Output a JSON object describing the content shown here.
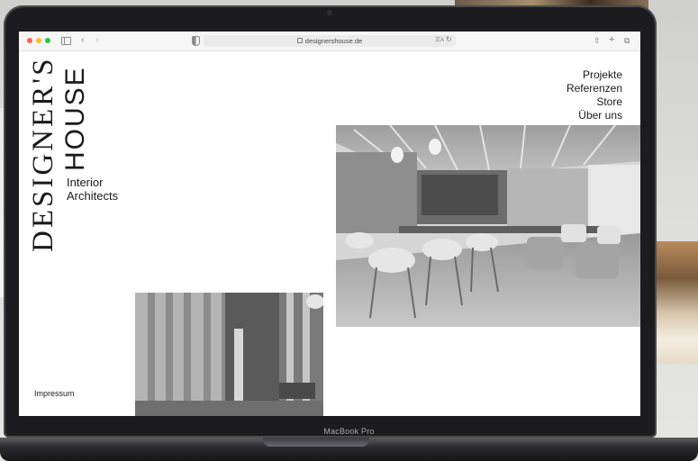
{
  "browser": {
    "url": "designershouse.de"
  },
  "site": {
    "logo_line1": "DESIGNER'S",
    "logo_line2": "HOUSE",
    "tagline": [
      "Interior",
      "Architects"
    ],
    "nav": [
      "Projekte",
      "Referenzen",
      "Store",
      "Über uns"
    ],
    "footer_link": "Impressum"
  },
  "device": {
    "brand_label": "MacBook Pro"
  },
  "colors": {
    "traffic_red": "#fe5f57",
    "traffic_yellow": "#febc2e",
    "traffic_green": "#28c840",
    "text": "#1a1a1a"
  }
}
